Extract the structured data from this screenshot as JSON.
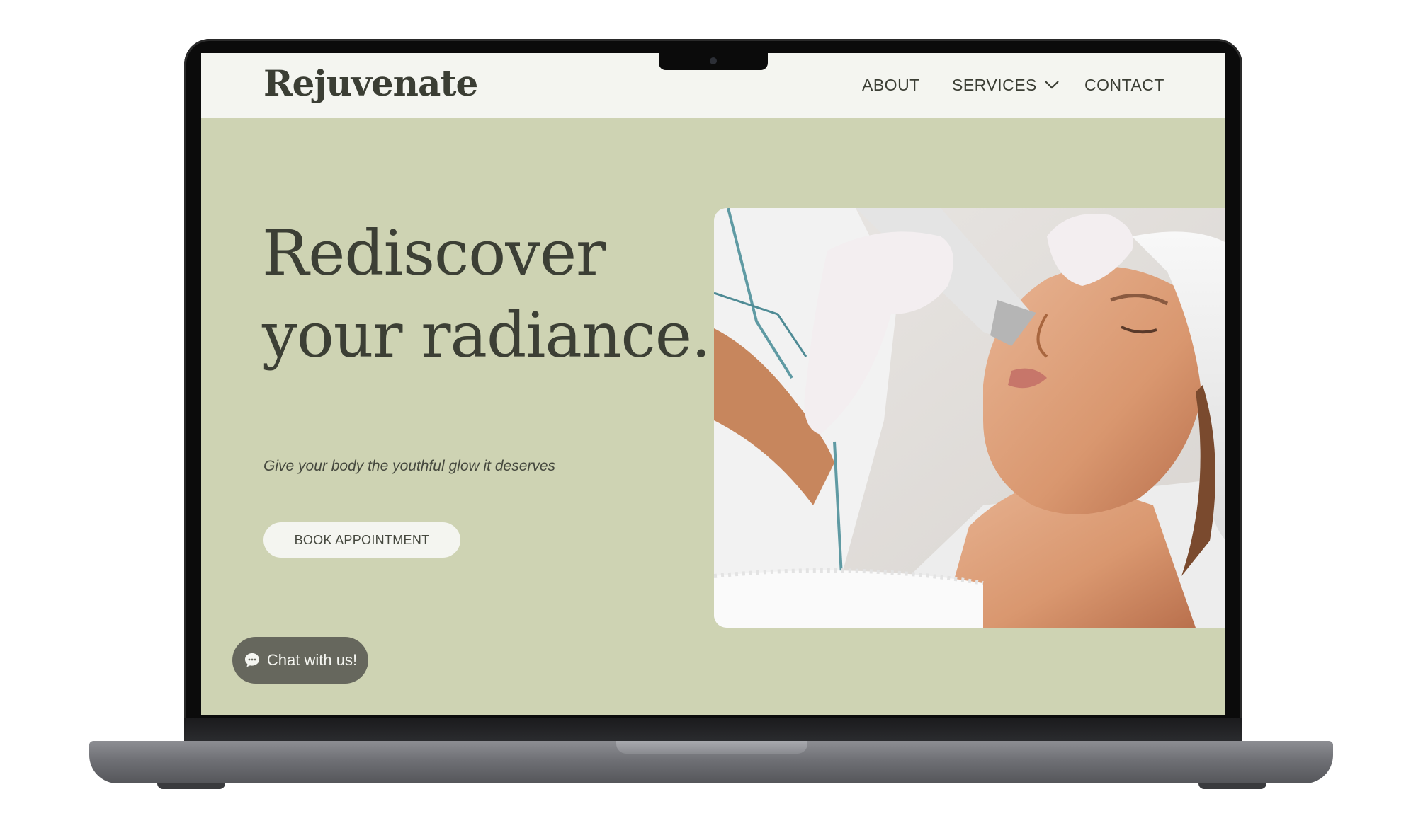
{
  "site": {
    "logo": "Rejuvenate",
    "nav": {
      "about": "ABOUT",
      "services": "SERVICES",
      "contact": "CONTACT"
    }
  },
  "hero": {
    "title_line1": "Rediscover",
    "title_line2": "your radiance.",
    "subtitle": "Give your body the youthful glow it deserves",
    "cta_label": "BOOK APPOINTMENT"
  },
  "chat": {
    "label": "Chat with us!"
  },
  "colors": {
    "hero_bg": "#ced3b3",
    "header_bg": "#f4f5f0",
    "text_dark": "#3c3f35",
    "chat_bg": "#66675d"
  },
  "icons": {
    "services_dropdown": "chevron-down-icon",
    "chat": "chat-bubble-icon"
  }
}
